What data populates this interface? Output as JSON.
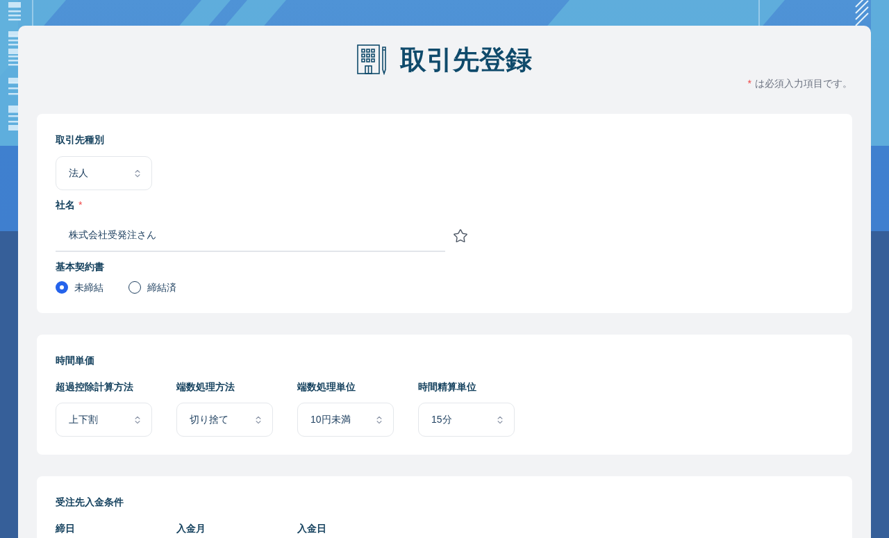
{
  "header": {
    "title": "取引先登録",
    "required_note": {
      "mark": "*",
      "text": "は必須入力項目です。"
    }
  },
  "sections": [
    {
      "kind": "basic",
      "fields": [
        {
          "kind": "select",
          "label": "取引先種別",
          "value": "法人"
        },
        {
          "kind": "text",
          "label": "社名",
          "required_mark": "*",
          "value": "株式会社受発注さん"
        },
        {
          "kind": "radio",
          "label": "基本契約書",
          "options": [
            {
              "label": "未締結",
              "selected": true
            },
            {
              "label": "締結済",
              "selected": false
            }
          ]
        }
      ]
    },
    {
      "kind": "grid",
      "title": "時間単価",
      "fields": [
        {
          "label": "超過控除計算方法",
          "value": "上下割"
        },
        {
          "label": "端数処理方法",
          "value": "切り捨て"
        },
        {
          "label": "端数処理単位",
          "value": "10円未満"
        },
        {
          "label": "時間精算単位",
          "value": "15分"
        }
      ]
    },
    {
      "kind": "grid",
      "title": "受注先入金条件",
      "fields": [
        {
          "label": "締日"
        },
        {
          "label": "入金月"
        },
        {
          "label": "入金日"
        }
      ]
    }
  ]
}
